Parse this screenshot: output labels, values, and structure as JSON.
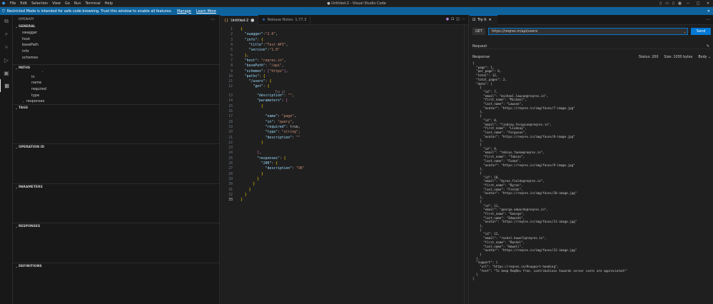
{
  "titlebar": {
    "menu": [
      "File",
      "Edit",
      "Selection",
      "View",
      "Go",
      "Run",
      "Terminal",
      "Help"
    ],
    "title": "● Untitled-2 - Visual Studio Code"
  },
  "banner": {
    "text": "Restricted Mode is intended for safe code browsing. Trust this window to enable all features.",
    "manage": "Manage",
    "learn_more": "Learn More"
  },
  "activitybar": {
    "icons": [
      "files-icon",
      "search-icon",
      "source-control-icon",
      "run-debug-icon",
      "extensions-icon",
      "openapi-icon"
    ]
  },
  "sidebar": {
    "title": "OPENAPI",
    "sections": {
      "general": {
        "title": "GENERAL",
        "items": [
          "swagger",
          "host",
          "basePath",
          "info",
          "schemes"
        ]
      },
      "paths": {
        "title": "PATHS",
        "items": [
          "description",
          "in",
          "name",
          "required",
          "type"
        ],
        "responses": "responses"
      },
      "tags": {
        "title": "TAGS"
      },
      "operation_id": {
        "title": "OPERATION ID"
      },
      "parameters": {
        "title": "PARAMETERS"
      },
      "responses": {
        "title": "RESPONSES"
      },
      "definitions": {
        "title": "DEFINITIONS"
      }
    }
  },
  "editor": {
    "tabs": [
      {
        "label": "Untitled-2",
        "modified": "●"
      },
      {
        "label": "Release Notes: 1.77.3",
        "close": "×"
      }
    ],
    "codelens": "Try it",
    "lines": [
      "{",
      "    \"swagger\":\"2.0\",",
      "    \"info\": {",
      "      \"title\":\"Test API\",",
      "      \"version\":\"1.0\"",
      "    },",
      "    \"host\": \"reqres.in\",",
      "    \"basePath\": \"/api\",",
      "    \"schemes\": [\"https\"],",
      "    \"paths\": {",
      "        \"/users\": {",
      "            \"get\": {",
      "                \"description\": \"\",",
      "                \"parameters\": [",
      "                    {",
      "",
      "                        \"name\": \"page\",",
      "                        \"in\": \"query\",",
      "                        \"required\": true,",
      "                        \"type\": \"string\",",
      "                        \"description\": \"\"",
      "                    }",
      "",
      "                ],",
      "                \"responses\": {",
      "                    \"200\": {",
      "                        \"description\": \"OK\"",
      "                    }",
      "                }",
      "            }",
      "        }",
      "    }",
      "}"
    ]
  },
  "tryit": {
    "tab_label": "Try it",
    "method": "GET",
    "url": "https://reqres.in/api/users",
    "send": "Send",
    "request_label": "Request",
    "response_label": "Response",
    "status": "Status: 200",
    "size": "Size: 1030 bytes",
    "body_label": "Body",
    "response_lines": [
      "{",
      "  \"page\": 1,",
      "  \"per_page\": 6,",
      "  \"total\": 12,",
      "  \"total_pages\": 2,",
      "  \"data\": [",
      "    {",
      "      \"id\": 7,",
      "      \"email\": \"michael.lawson@reqres.in\",",
      "      \"first_name\": \"Michael\",",
      "      \"last_name\": \"Lawson\",",
      "      \"avatar\": \"https://reqres.in/img/faces/7-image.jpg\"",
      "    },",
      "    {",
      "      \"id\": 8,",
      "      \"email\": \"lindsay.ferguson@reqres.in\",",
      "      \"first_name\": \"Lindsay\",",
      "      \"last_name\": \"Ferguson\",",
      "      \"avatar\": \"https://reqres.in/img/faces/8-image.jpg\"",
      "    },",
      "    {",
      "      \"id\": 9,",
      "      \"email\": \"tobias.funke@reqres.in\",",
      "      \"first_name\": \"Tobias\",",
      "      \"last_name\": \"Funke\",",
      "      \"avatar\": \"https://reqres.in/img/faces/9-image.jpg\"",
      "    },",
      "    {",
      "      \"id\": 10,",
      "      \"email\": \"byron.fields@reqres.in\",",
      "      \"first_name\": \"Byron\",",
      "      \"last_name\": \"Fields\",",
      "      \"avatar\": \"https://reqres.in/img/faces/10-image.jpg\"",
      "    },",
      "    {",
      "      \"id\": 11,",
      "      \"email\": \"george.edwards@reqres.in\",",
      "      \"first_name\": \"George\",",
      "      \"last_name\": \"Edwards\",",
      "      \"avatar\": \"https://reqres.in/img/faces/11-image.jpg\"",
      "    },",
      "    {",
      "      \"id\": 12,",
      "      \"email\": \"rachel.howell@reqres.in\",",
      "      \"first_name\": \"Rachel\",",
      "      \"last_name\": \"Howell\",",
      "      \"avatar\": \"https://reqres.in/img/faces/12-image.jpg\"",
      "    }",
      "  ],",
      "  \"support\": {",
      "    \"url\": \"https://reqres.in/#support-heading\",",
      "    \"text\": \"To keep ReqRes free, contributions towards server costs are appreciated!\"",
      "  }",
      "}"
    ]
  },
  "colors": {
    "accent": "#0078d4",
    "banner": "#0e639c",
    "background": "#1e1e1e"
  }
}
